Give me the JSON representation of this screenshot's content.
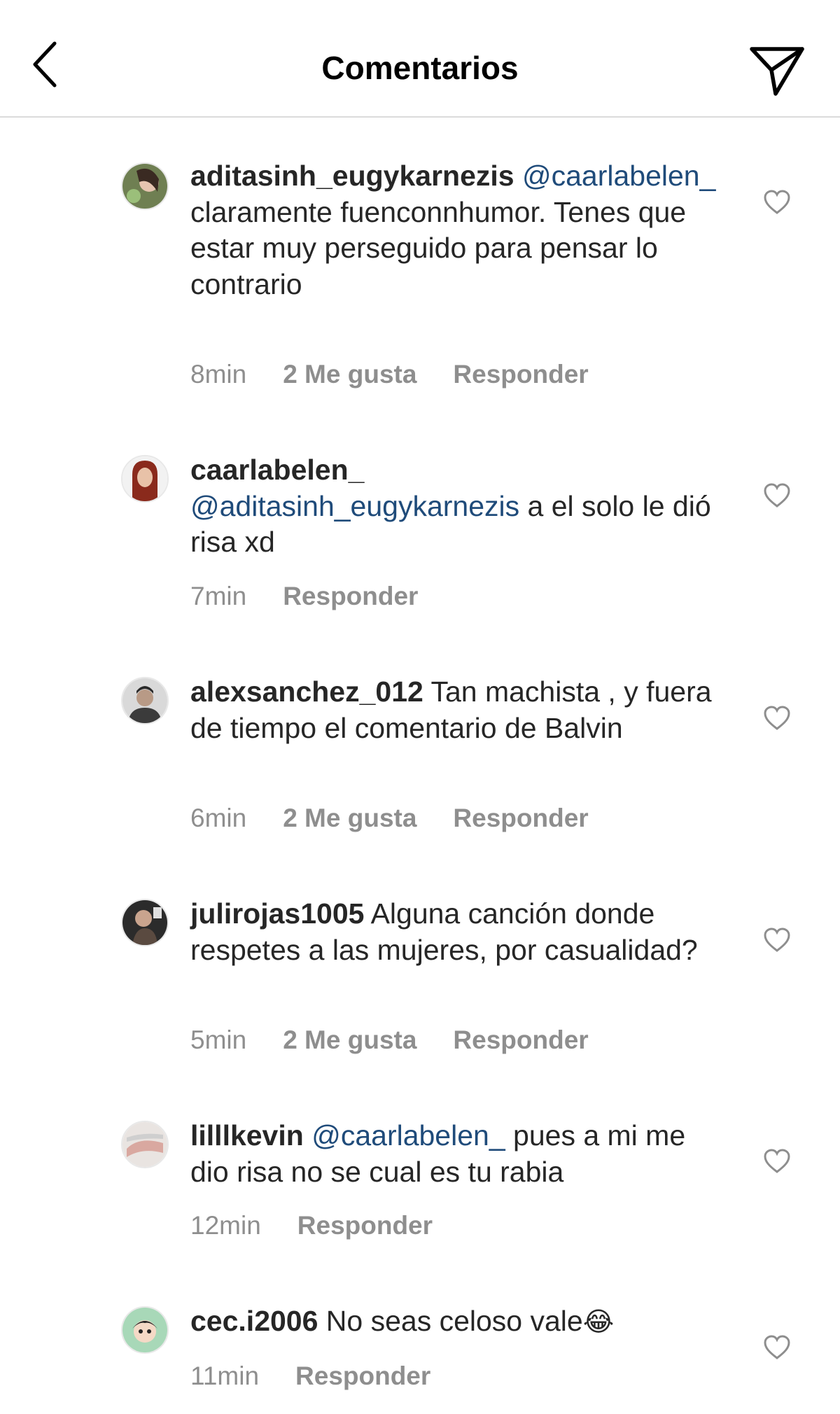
{
  "header": {
    "title": "Comentarios",
    "back_icon": "chevron-left-icon",
    "share_icon": "paper-plane-icon"
  },
  "comments": [
    {
      "username": "aditasinh_eugykarnezis",
      "mention": "@caarlabelen_",
      "text": " claramente fuenconnhumor. Tenes que estar muy perseguido para pensar lo contrario",
      "time": "8min",
      "likes": "2 Me gusta",
      "reply": "Responder"
    },
    {
      "username": "caarlabelen_",
      "mention": "@aditasinh_eugykarnezis",
      "text": " a el solo le dió risa xd",
      "time": "7min",
      "reply": "Responder"
    },
    {
      "username": "alexsanchez_012",
      "text": " Tan machista , y fuera de tiempo el comentario de Balvin",
      "time": "6min",
      "likes": "2 Me gusta",
      "reply": "Responder"
    },
    {
      "username": "julirojas1005",
      "text": " Alguna canción donde respetes a las mujeres, por casualidad?",
      "time": "5min",
      "likes": "2 Me gusta",
      "reply": "Responder"
    },
    {
      "username": "lilllkevin",
      "mention": "@caarlabelen_",
      "text": " pues a mi me dio risa no se cual es tu rabia",
      "time": "12min",
      "reply": "Responder"
    },
    {
      "username": "cec.i2006",
      "text": " No seas celoso vale",
      "emoji": "😂",
      "time": "11min",
      "reply": "Responder"
    }
  ],
  "colors": {
    "text": "#262626",
    "mention": "#1f4b7a",
    "meta": "#8e8e8e",
    "divider": "#dbdbdb"
  }
}
